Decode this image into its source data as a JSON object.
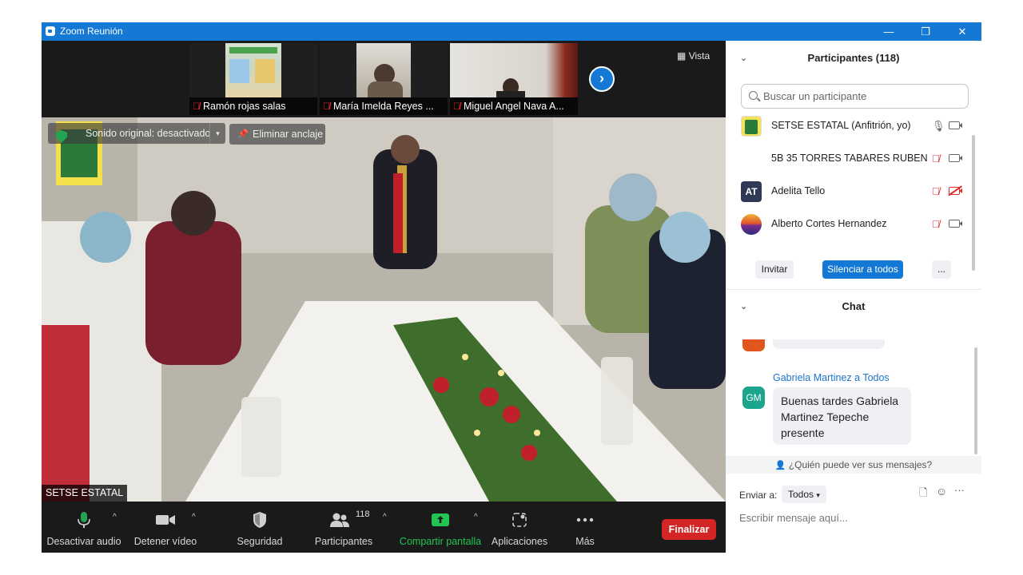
{
  "window": {
    "title": "Zoom Reunión",
    "controls": [
      "—",
      "❐",
      "✕"
    ]
  },
  "gallery": {
    "thumbnails": [
      {
        "name": "Ramón rojas salas"
      },
      {
        "name": "María Imelda Reyes ..."
      },
      {
        "name": "Miguel Angel Nava A..."
      }
    ],
    "view_label": "Vista"
  },
  "main_video": {
    "speaker_name": "SETSE ESTATAL",
    "original_sound": "Sonido original: desactivado",
    "unpin": "Eliminar anclaje"
  },
  "toolbar": {
    "mute": "Desactivar audio",
    "video": "Detener vídeo",
    "security": "Seguridad",
    "participants": "Participantes",
    "participants_count": "118",
    "share": "Compartir pantalla",
    "apps": "Aplicaciones",
    "more": "Más",
    "end": "Finalizar"
  },
  "participants_panel": {
    "header": "Participantes (118)",
    "search_placeholder": "Buscar un participante",
    "items": [
      {
        "name": "SETSE ESTATAL (Anfitrión, yo)",
        "initials": "",
        "avatar_color": "#f2e25a"
      },
      {
        "name": "5B 35 TORRES TABARES RUBEN ...",
        "initials": "",
        "avatar_color": "#ffffff"
      },
      {
        "name": "Adelita Tello",
        "initials": "AT",
        "avatar_color": "#2e3a55"
      },
      {
        "name": "Alberto Cortes Hernandez",
        "initials": "",
        "avatar_color": "#7a2f8c"
      }
    ],
    "invite": "Invitar",
    "mute_all": "Silenciar a todos",
    "more": "..."
  },
  "chat_panel": {
    "header": "Chat",
    "message": {
      "meta": "Gabriela Martinez a Todos",
      "avatar": "GM",
      "text": "Buenas tardes Gabriela Martinez Tepeche presente"
    },
    "who_sees": "¿Quién puede ver sus mensajes?",
    "send_to_label": "Enviar a:",
    "send_to_value": "Todos",
    "input_placeholder": "Escribir mensaje aquí..."
  },
  "colors": {
    "titlebar": "#1479d4",
    "accent_blue": "#1479d4",
    "end_red": "#d42525",
    "share_green": "#23c552"
  }
}
